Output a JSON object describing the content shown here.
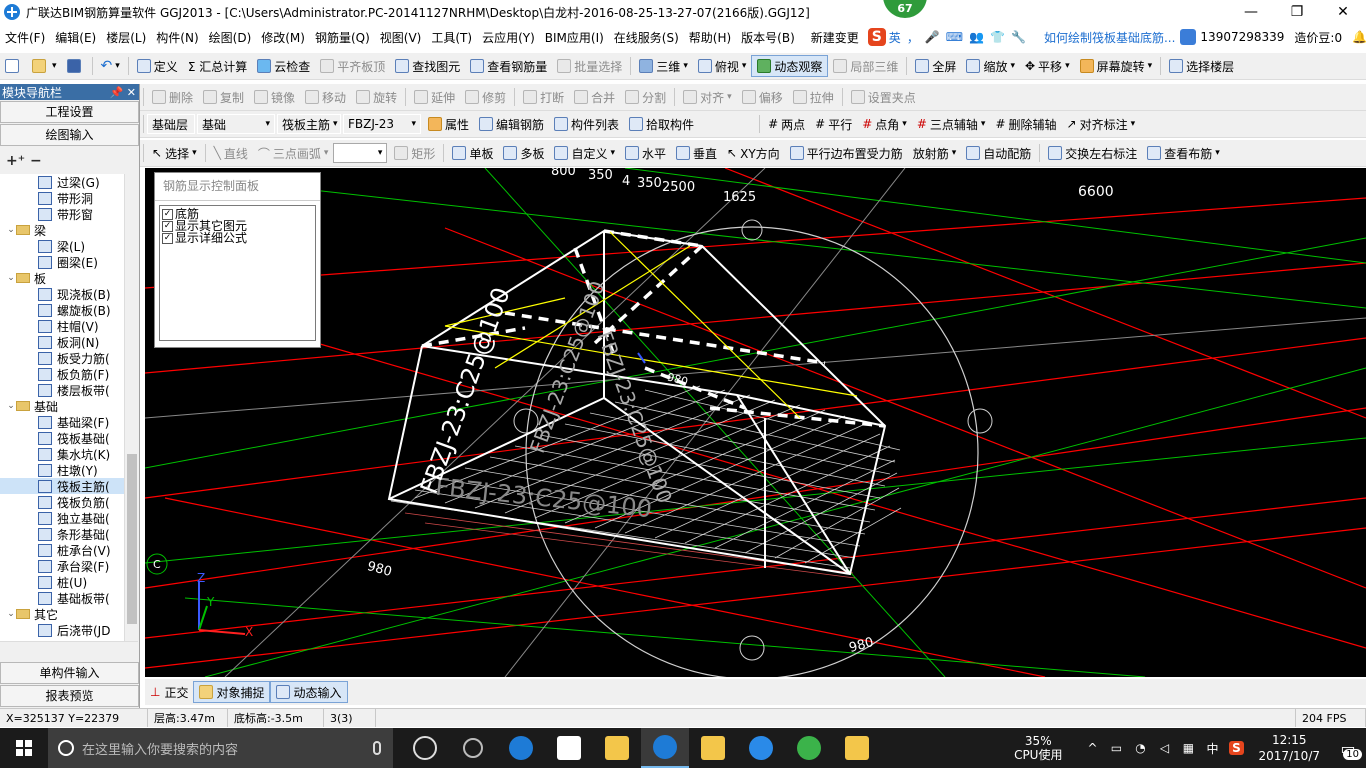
{
  "window": {
    "title": "广联达BIM钢筋算量软件 GGJ2013 - [C:\\Users\\Administrator.PC-20141127NRHM\\Desktop\\白龙村-2016-08-25-13-27-07(2166版).GGJ12]",
    "badge": "67",
    "minimize": "—",
    "maximize": "❐",
    "close": "✕"
  },
  "menu": {
    "items": [
      "文件(F)",
      "编辑(E)",
      "楼层(L)",
      "构件(N)",
      "绘图(D)",
      "修改(M)",
      "钢筋量(Q)",
      "视图(V)",
      "工具(T)",
      "云应用(Y)",
      "BIM应用(I)",
      "在线服务(S)",
      "帮助(H)",
      "版本号(B)"
    ],
    "new_change": "新建变更",
    "ime_labels": [
      "英",
      "，",
      "🎤",
      "⌨",
      "👥",
      "👕",
      "🔧"
    ],
    "marquee": "如何绘制筏板基础底筋...",
    "phone": "13907298339",
    "zaojia": "造价豆:0",
    "bell": "🔔"
  },
  "toolbar1": {
    "items": [
      "定义",
      "Σ 汇总计算",
      "云检查",
      "平齐板顶",
      "查找图元",
      "查看钢筋量",
      "批量选择",
      "三维",
      "俯视",
      "动态观察",
      "局部三维",
      "全屏",
      "缩放",
      "平移",
      "屏幕旋转",
      "选择楼层"
    ]
  },
  "toolbar2": {
    "items": [
      "删除",
      "复制",
      "镜像",
      "移动",
      "旋转",
      "延伸",
      "修剪",
      "打断",
      "合并",
      "分割",
      "对齐",
      "偏移",
      "拉伸",
      "设置夹点"
    ]
  },
  "toolbar3": {
    "floor": "基础层",
    "category": "基础",
    "type": "筏板主筋",
    "member": "FBZJ-23",
    "items": [
      "属性",
      "编辑钢筋",
      "构件列表",
      "拾取构件",
      "两点",
      "平行",
      "点角",
      "三点辅轴",
      "删除辅轴",
      "对齐标注"
    ]
  },
  "toolbar4": {
    "items": [
      "选择",
      "直线",
      "三点画弧",
      "矩形",
      "单板",
      "多板",
      "自定义",
      "水平",
      "垂直",
      "XY方向",
      "平行边布置受力筋",
      "放射筋",
      "自动配筋",
      "交换左右标注",
      "查看布筋"
    ]
  },
  "sidebar": {
    "title": "模块导航栏",
    "pin": "📌 ✕",
    "btn_project": "工程设置",
    "btn_draw": "绘图输入",
    "tools": "+⁺ −",
    "tree": [
      {
        "level": 2,
        "label": "过梁(G)"
      },
      {
        "level": 2,
        "label": "带形洞"
      },
      {
        "level": 2,
        "label": "带形窗"
      },
      {
        "level": 1,
        "label": "梁",
        "expanded": true
      },
      {
        "level": 2,
        "label": "梁(L)"
      },
      {
        "level": 2,
        "label": "圈梁(E)"
      },
      {
        "level": 1,
        "label": "板",
        "expanded": true
      },
      {
        "level": 2,
        "label": "现浇板(B)"
      },
      {
        "level": 2,
        "label": "螺旋板(B)"
      },
      {
        "level": 2,
        "label": "柱帽(V)"
      },
      {
        "level": 2,
        "label": "板洞(N)"
      },
      {
        "level": 2,
        "label": "板受力筋("
      },
      {
        "level": 2,
        "label": "板负筋(F)"
      },
      {
        "level": 2,
        "label": "楼层板带("
      },
      {
        "level": 1,
        "label": "基础",
        "expanded": true
      },
      {
        "level": 2,
        "label": "基础梁(F)"
      },
      {
        "level": 2,
        "label": "筏板基础("
      },
      {
        "level": 2,
        "label": "集水坑(K)"
      },
      {
        "level": 2,
        "label": "柱墩(Y)"
      },
      {
        "level": 2,
        "label": "筏板主筋(",
        "selected": true
      },
      {
        "level": 2,
        "label": "筏板负筋("
      },
      {
        "level": 2,
        "label": "独立基础("
      },
      {
        "level": 2,
        "label": "条形基础("
      },
      {
        "level": 2,
        "label": "桩承台(V)"
      },
      {
        "level": 2,
        "label": "承台梁(F)"
      },
      {
        "level": 2,
        "label": "桩(U)"
      },
      {
        "level": 2,
        "label": "基础板带("
      },
      {
        "level": 1,
        "label": "其它",
        "expanded": true
      },
      {
        "level": 2,
        "label": "后浇带(JD"
      }
    ],
    "btn_single": "单构件输入",
    "btn_report": "报表预览"
  },
  "panel": {
    "title": "钢筋显示控制面板",
    "options": [
      {
        "label": "底筋",
        "checked": true
      },
      {
        "label": "显示其它图元",
        "checked": true
      },
      {
        "label": "显示详细公式",
        "checked": true
      }
    ]
  },
  "viewport": {
    "dims": [
      "800",
      "350",
      "4",
      "350",
      "2500",
      "1625",
      "6600",
      "980",
      "980",
      "980"
    ],
    "axis_c": "C",
    "annotations": [
      "FBZJ-23:C25@100",
      "FBZJ-23:C25@100",
      "FBZJ-23:C25@100",
      "FBZJ-23:C25@100"
    ],
    "axis_z": "Z",
    "axis_y": "Y",
    "axis_x": "X"
  },
  "snapbar": {
    "ortho": "正交",
    "snap": "对象捕捉",
    "dynamic": "动态输入"
  },
  "status": {
    "coords": "X=325137  Y=22379",
    "floor_height": "层高:3.47m",
    "base_elev": "底标高:-3.5m",
    "count": "3(3)",
    "fps": "204 FPS"
  },
  "taskbar": {
    "search_placeholder": "在这里输入你要搜索的内容",
    "cpu_value": "35%",
    "cpu_label": "CPU使用",
    "ime_lang": "中",
    "time": "12:15",
    "date": "2017/10/7",
    "notif_count": "10"
  },
  "colors": {
    "viewport_bg": "#000000",
    "selection_blue": "#3a6ea5",
    "grid_red": "#ff0000",
    "grid_green": "#00c000",
    "rebar_yellow": "#ffff00"
  }
}
